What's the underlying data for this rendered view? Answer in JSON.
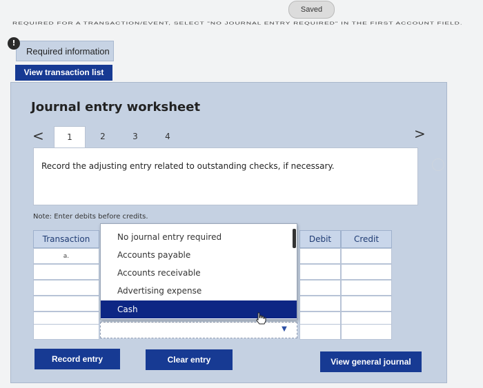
{
  "header": {
    "saved_label": "Saved",
    "instruction": "required for a transaction/event, select \"No journal entry required\" in the first account field."
  },
  "required_info": {
    "icon_symbol": "!",
    "label": "Required information"
  },
  "view_transaction_list_label": "View transaction list",
  "worksheet": {
    "title": "Journal entry worksheet",
    "prev_symbol": "<",
    "next_symbol": ">",
    "tabs": [
      {
        "label": "1",
        "active": true
      },
      {
        "label": "2",
        "active": false
      },
      {
        "label": "3",
        "active": false
      },
      {
        "label": "4",
        "active": false
      }
    ],
    "prompt": "Record the adjusting entry related to outstanding checks, if necessary.",
    "note": "Note: Enter debits before credits."
  },
  "table": {
    "headers": {
      "transaction": "Transaction",
      "debit": "Debit",
      "credit": "Credit"
    },
    "rows": [
      {
        "transaction": "a."
      },
      {
        "transaction": ""
      },
      {
        "transaction": ""
      },
      {
        "transaction": ""
      },
      {
        "transaction": ""
      },
      {
        "transaction": ""
      }
    ]
  },
  "account_dropdown": {
    "options": [
      "No journal entry required",
      "Accounts payable",
      "Accounts receivable",
      "Advertising expense",
      "Cash"
    ],
    "highlighted": "Cash",
    "arrow_symbol": "▼"
  },
  "buttons": {
    "record_entry": "Record entry",
    "clear_entry": "Clear entry",
    "view_general_journal": "View general journal"
  },
  "colors": {
    "primary_button": "#173a93",
    "panel_bg": "#c5d1e2",
    "selected_option": "#0d2684"
  }
}
